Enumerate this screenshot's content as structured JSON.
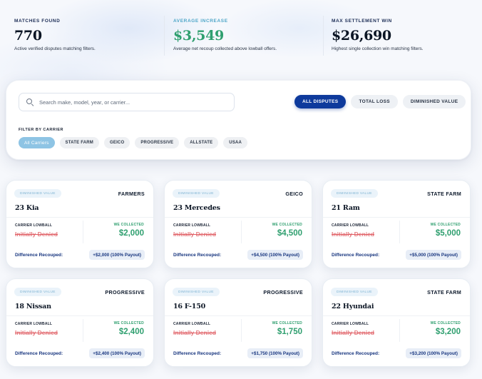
{
  "stats": [
    {
      "label": "MATCHES FOUND",
      "value": "770",
      "desc": "Active verified disputes matching filters."
    },
    {
      "label": "AVERAGE INCREASE",
      "value": "$3,549",
      "desc": "Average net recoup collected above lowball offers."
    },
    {
      "label": "MAX SETTLEMENT WIN",
      "value": "$26,690",
      "desc": "Highest single collection win matching filters."
    }
  ],
  "search": {
    "placeholder": "Search make, model, year, or carrier..."
  },
  "tabs": [
    {
      "label": "ALL DISPUTES",
      "active": true
    },
    {
      "label": "TOTAL LOSS",
      "active": false
    },
    {
      "label": "DIMINISHED VALUE",
      "active": false
    }
  ],
  "filter": {
    "label": "FILTER BY CARRIER",
    "carriers": [
      "All Carriers",
      "STATE FARM",
      "GEICO",
      "PROGRESSIVE",
      "ALLSTATE",
      "USAA"
    ]
  },
  "card_labels": {
    "lowball": "CARRIER LOWBALL",
    "collected": "WE COLLECTED",
    "difference": "Difference Recouped:"
  },
  "cards": [
    {
      "badge": "DIMINISHED VALUE",
      "carrier": "FARMERS",
      "vehicle": "23 Kia",
      "lowball": "Initially Denied",
      "collected": "$2,000",
      "difference": "+$2,000 (100% Payout)"
    },
    {
      "badge": "DIMINISHED VALUE",
      "carrier": "GEICO",
      "vehicle": "23 Mercedes",
      "lowball": "Initially Denied",
      "collected": "$4,500",
      "difference": "+$4,500 (100% Payout)"
    },
    {
      "badge": "DIMINISHED VALUE",
      "carrier": "STATE FARM",
      "vehicle": "21 Ram",
      "lowball": "Initially Denied",
      "collected": "$5,000",
      "difference": "+$5,000 (100% Payout)"
    },
    {
      "badge": "DIMINISHED VALUE",
      "carrier": "PROGRESSIVE",
      "vehicle": "18 Nissan",
      "lowball": "Initially Denied",
      "collected": "$2,400",
      "difference": "+$2,400 (100% Payout)"
    },
    {
      "badge": "DIMINISHED VALUE",
      "carrier": "PROGRESSIVE",
      "vehicle": "16 F-150",
      "lowball": "Initially Denied",
      "collected": "$1,750",
      "difference": "+$1,750 (100% Payout)"
    },
    {
      "badge": "DIMINISHED VALUE",
      "carrier": "STATE FARM",
      "vehicle": "22 Hyundai",
      "lowball": "Initially Denied",
      "collected": "$3,200",
      "difference": "+$3,200 (100% Payout)"
    }
  ],
  "colors": {
    "accent": "#0e3a9c",
    "success": "#2f9f6f",
    "danger": "#e57b80",
    "chip_active": "#8ec4e4"
  }
}
